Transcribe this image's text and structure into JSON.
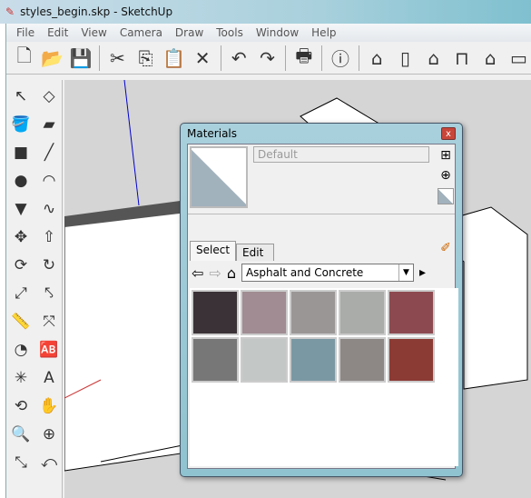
{
  "window": {
    "title": "styles_begin.skp - SketchUp"
  },
  "menu": [
    "File",
    "Edit",
    "View",
    "Camera",
    "Draw",
    "Tools",
    "Window",
    "Help"
  ],
  "toolbar": [
    {
      "name": "new-icon",
      "glyph": "🗋"
    },
    {
      "name": "open-icon",
      "glyph": "📂"
    },
    {
      "name": "save-icon",
      "glyph": "💾"
    },
    {
      "sep": true
    },
    {
      "name": "cut-icon",
      "glyph": "✂"
    },
    {
      "name": "copy-icon",
      "glyph": "⎘"
    },
    {
      "name": "paste-icon",
      "glyph": "📋"
    },
    {
      "name": "erase-icon",
      "glyph": "✕"
    },
    {
      "sep": true
    },
    {
      "name": "undo-icon",
      "glyph": "↶"
    },
    {
      "name": "redo-icon",
      "glyph": "↷"
    },
    {
      "sep": true
    },
    {
      "name": "print-icon",
      "glyph": "🖶"
    },
    {
      "sep": true
    },
    {
      "name": "model-info-icon",
      "glyph": "ⓘ"
    },
    {
      "sep": true
    },
    {
      "name": "iso-view-icon",
      "glyph": "⌂"
    },
    {
      "name": "top-view-icon",
      "glyph": "▯"
    },
    {
      "name": "front-view-icon",
      "glyph": "⌂"
    },
    {
      "name": "right-view-icon",
      "glyph": "⊓"
    },
    {
      "name": "back-view-icon",
      "glyph": "⌂"
    },
    {
      "name": "left-view-icon",
      "glyph": "▭"
    }
  ],
  "left_tools": [
    "select-icon",
    "make-component-icon",
    "paint-bucket-icon",
    "eraser-icon",
    "rectangle-icon",
    "line-icon",
    "circle-icon",
    "arc-icon",
    "polygon-icon",
    "freehand-icon",
    "move-icon",
    "push-pull-icon",
    "rotate-icon",
    "follow-me-icon",
    "scale-icon",
    "offset-icon",
    "tape-measure-icon",
    "dimension-icon",
    "protractor-icon",
    "text-icon",
    "axes-icon",
    "3d-text-icon",
    "orbit-icon",
    "pan-icon",
    "zoom-icon",
    "zoom-window-icon",
    "zoom-extents-icon",
    "previous-icon"
  ],
  "left_glyphs": [
    "↖",
    "◇",
    "🪣",
    "▰",
    "■",
    "╱",
    "●",
    "◠",
    "▼",
    "∿",
    "✥",
    "⇧",
    "⟳",
    "↻",
    "⤢",
    "⤣",
    "📏",
    "⤧",
    "◔",
    "🆎",
    "✳",
    "A",
    "⟲",
    "✋",
    "🔍",
    "⊕",
    "⤡",
    "⤺"
  ],
  "materials": {
    "title": "Materials",
    "close": "x",
    "name_value": "Default",
    "tabs": [
      "Select",
      "Edit"
    ],
    "collection": "Asphalt and Concrete",
    "swatches": [
      "#3a3236",
      "#a08c92",
      "#9a9696",
      "#a9aca8",
      "#8c4a50",
      "#777",
      "#c3c7c6",
      "#7a98a4",
      "#8d8886",
      "#8b3a34"
    ]
  },
  "colors": {
    "accent": "#8fc3cf"
  }
}
